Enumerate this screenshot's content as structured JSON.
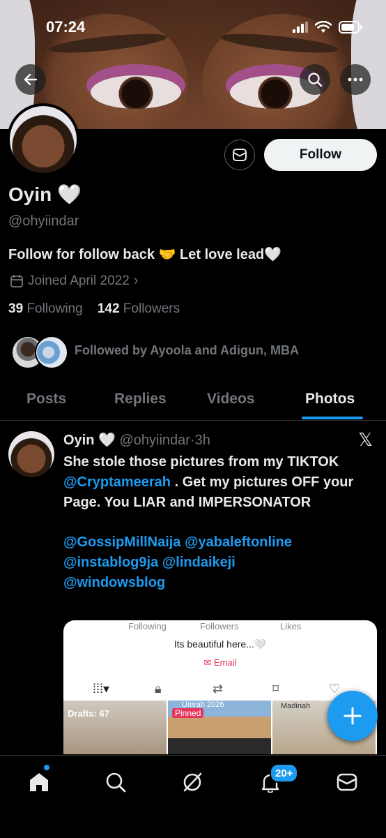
{
  "status_bar": {
    "time": "07:24"
  },
  "profile": {
    "name": "Oyin 🤍",
    "handle": "@ohyiindar",
    "bio": "Follow for follow back 🤝 Let love lead🤍",
    "joined": "Joined April 2022",
    "following_count": "39",
    "following_label": "Following",
    "followers_count": "142",
    "followers_label": "Followers",
    "followed_by": "Followed by Ayoola and Adigun, MBA",
    "follow_button": "Follow"
  },
  "tabs": [
    {
      "label": "Posts"
    },
    {
      "label": "Replies"
    },
    {
      "label": "Videos"
    },
    {
      "label": "Photos",
      "active": true
    }
  ],
  "tweet": {
    "author": "Oyin 🤍",
    "handle": "@ohyiindar",
    "separator": "·",
    "time": "3h",
    "text_1": "She stole those pictures from my TIKTOK",
    "mention_1": "@Cryptameerah",
    "text_2": ". Get my pictures OFF your Page. You LIAR and IMPERSONATOR",
    "mention_2": "@GossipMillNaija",
    "mention_3": "@yabaleftonline",
    "mention_4": "@instablog9ja",
    "mention_5": "@lindaikeji",
    "mention_6": "@windowsblog"
  },
  "embed": {
    "following": "Following",
    "followers": "Followers",
    "likes": "Likes",
    "bio": "Its beautiful here...🤍",
    "email": "Email",
    "drafts": "Drafts: 67",
    "pinned": "Pinned",
    "umrah": "Umrah 2026",
    "madinah": "Madinah"
  },
  "nav": {
    "notifications_badge": "20+"
  },
  "colors": {
    "accent": "#1d9bf0",
    "background": "#000000",
    "muted": "#71767b"
  }
}
